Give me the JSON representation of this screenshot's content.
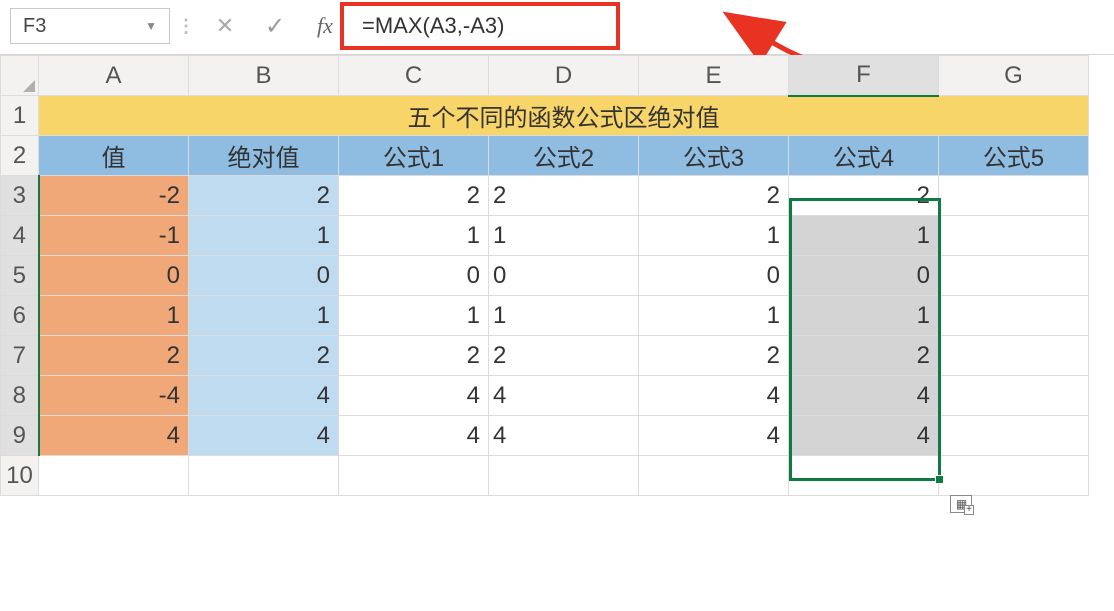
{
  "name_box": "F3",
  "formula": "=MAX(A3,-A3)",
  "fx_label": "fx",
  "col_headers": [
    "A",
    "B",
    "C",
    "D",
    "E",
    "F",
    "G"
  ],
  "row_headers": [
    "1",
    "2",
    "3",
    "4",
    "5",
    "6",
    "7",
    "8",
    "9",
    "10"
  ],
  "title": "五个不同的函数公式区绝对值",
  "field_headers": [
    "值",
    "绝对值",
    "公式1",
    "公式2",
    "公式3",
    "公式4",
    "公式5"
  ],
  "rows": [
    {
      "val": "-2",
      "abs": "2",
      "c": "2",
      "d": "2",
      "e": "2",
      "f": "2"
    },
    {
      "val": "-1",
      "abs": "1",
      "c": "1",
      "d": "1",
      "e": "1",
      "f": "1"
    },
    {
      "val": "0",
      "abs": "0",
      "c": "0",
      "d": "0",
      "e": "0",
      "f": "0"
    },
    {
      "val": "1",
      "abs": "1",
      "c": "1",
      "d": "1",
      "e": "1",
      "f": "1"
    },
    {
      "val": "2",
      "abs": "2",
      "c": "2",
      "d": "2",
      "e": "2",
      "f": "2"
    },
    {
      "val": "-4",
      "abs": "4",
      "c": "4",
      "d": "4",
      "e": "4",
      "f": "4"
    },
    {
      "val": "4",
      "abs": "4",
      "c": "4",
      "d": "4",
      "e": "4",
      "f": "4"
    }
  ],
  "selected_col": "F",
  "selected_rows_from": 3,
  "selected_rows_to": 9,
  "colors": {
    "title_bg": "#f8d568",
    "header_bg": "#8fbde2",
    "val_bg": "#f0a878",
    "abs_bg": "#bedbf0",
    "sel_border": "#0f7b42",
    "annotation": "#e83323"
  }
}
